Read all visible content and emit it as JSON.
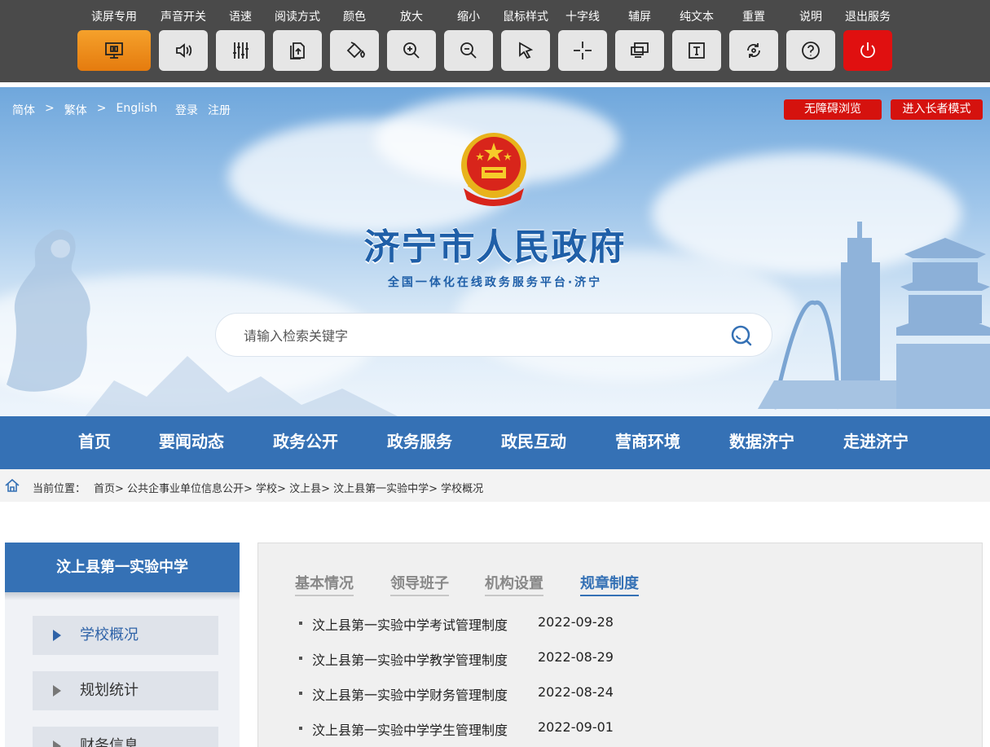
{
  "toolbar": {
    "items": [
      {
        "label": "读屏专用",
        "icon": "monitor-icon"
      },
      {
        "label": "声音开关",
        "icon": "speaker-icon"
      },
      {
        "label": "语速",
        "icon": "sliders-icon"
      },
      {
        "label": "阅读方式",
        "icon": "read-mode-icon"
      },
      {
        "label": "颜色",
        "icon": "paint-bucket-icon"
      },
      {
        "label": "放大",
        "icon": "zoom-in-icon"
      },
      {
        "label": "缩小",
        "icon": "zoom-out-icon"
      },
      {
        "label": "鼠标样式",
        "icon": "cursor-icon"
      },
      {
        "label": "十字线",
        "icon": "crosshair-icon"
      },
      {
        "label": "辅屏",
        "icon": "second-screen-icon"
      },
      {
        "label": "纯文本",
        "icon": "text-icon"
      },
      {
        "label": "重置",
        "icon": "reset-icon"
      },
      {
        "label": "说明",
        "icon": "help-icon"
      },
      {
        "label": "退出服务",
        "icon": "power-icon"
      }
    ]
  },
  "header": {
    "lang": {
      "simplified": "简体",
      "sep": ">",
      "traditional": "繁体",
      "english": "English"
    },
    "login": "登录",
    "register": "注册",
    "accessible_btn": "无障碍浏览",
    "elder_btn": "进入长者模式",
    "title": "济宁市人民政府",
    "subtitle": "全国一体化在线政务服务平台·济宁",
    "search_placeholder": "请输入检索关键字"
  },
  "nav": {
    "items": [
      "首页",
      "要闻动态",
      "政务公开",
      "政务服务",
      "政民互动",
      "营商环境",
      "数据济宁",
      "走进济宁"
    ]
  },
  "breadcrumb": {
    "label": "当前位置：",
    "path": "首页> 公共企事业单位信息公开> 学校> 汶上县> 汶上县第一实验中学> 学校概况"
  },
  "sidebar": {
    "title": "汶上县第一实验中学",
    "items": [
      "学校概况",
      "规划统计",
      "财务信息"
    ]
  },
  "main": {
    "tabs": [
      "基本情况",
      "领导班子",
      "机构设置",
      "规章制度"
    ],
    "active_tab": "规章制度",
    "list": [
      {
        "title": "汶上县第一实验中学考试管理制度",
        "date": "2022-09-28"
      },
      {
        "title": "汶上县第一实验中学教学管理制度",
        "date": "2022-08-29"
      },
      {
        "title": "汶上县第一实验中学财务管理制度",
        "date": "2022-08-24"
      },
      {
        "title": "汶上县第一实验中学学生管理制度",
        "date": "2022-09-01"
      }
    ]
  },
  "colors": {
    "primary": "#3571b5",
    "alert_red": "#d5120e",
    "toolbar_bg": "#4a4a4a",
    "active_orange": "#f08c1c"
  }
}
